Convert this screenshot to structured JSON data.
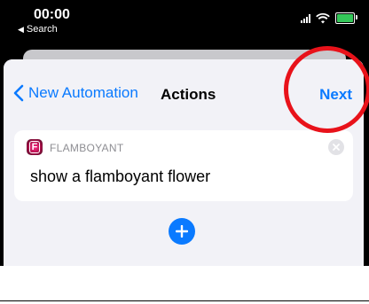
{
  "status_bar": {
    "time": "00:00",
    "back_label": "Search",
    "battery_color": "#34c759"
  },
  "nav": {
    "back_label": "New Automation",
    "title": "Actions",
    "next_label": "Next"
  },
  "action": {
    "app_icon": "flamboyant-app-icon",
    "app_icon_letter": "F",
    "app_name": "FLAMBOYANT",
    "text": "show a flamboyant flower"
  },
  "colors": {
    "accent": "#0a7aff",
    "annotation": "#e8121a",
    "sheet_background": "#f2f2f7"
  }
}
